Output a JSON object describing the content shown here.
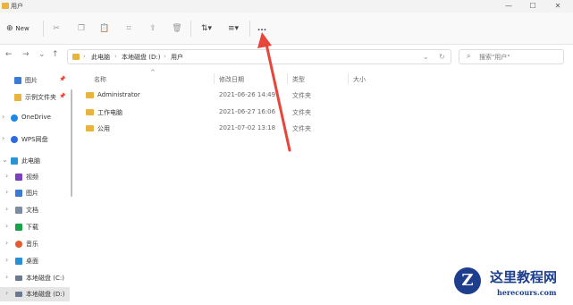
{
  "window": {
    "title": "用户",
    "min": "—",
    "max": "☐",
    "close": "✕"
  },
  "toolbar": {
    "new_label": "New",
    "icons": [
      "cut-icon",
      "copy-icon",
      "paste-icon",
      "rename-icon",
      "share-icon",
      "delete-icon",
      "sort-icon",
      "view-icon",
      "more-icon"
    ],
    "more_label": "..."
  },
  "address": {
    "crumbs": [
      "此电脑",
      "本地磁盘 (D:)",
      "用户"
    ],
    "search_placeholder": "搜索\"用户\""
  },
  "sidebar": {
    "items": [
      {
        "label": "图片",
        "pinned": true,
        "color": "#3a7bd5"
      },
      {
        "label": "示例文件夹",
        "pinned": true,
        "color": "#e8b43c"
      },
      {
        "label": "OneDrive",
        "color": "#1e88e5"
      },
      {
        "label": "WPS网盘",
        "color": "#2d6cdf"
      },
      {
        "label": "此电脑",
        "color": "#2a93d5"
      },
      {
        "label": "视频",
        "color": "#7b3fbf"
      },
      {
        "label": "图片",
        "color": "#3a7bd5"
      },
      {
        "label": "文档",
        "color": "#7d8ca3"
      },
      {
        "label": "下载",
        "color": "#1aa24b"
      },
      {
        "label": "音乐",
        "color": "#e45b2f"
      },
      {
        "label": "桌面",
        "color": "#2b8fd6"
      },
      {
        "label": "本地磁盘 (C:)",
        "color": "#6b7b8f"
      },
      {
        "label": "本地磁盘 (D:)",
        "color": "#6b7b8f"
      }
    ]
  },
  "main": {
    "columns": {
      "name": "名称",
      "date": "修改日期",
      "type": "类型",
      "size": "大小"
    },
    "rows": [
      {
        "name": "Administrator",
        "date": "2021-06-26 14:49",
        "type": "文件夹"
      },
      {
        "name": "工作电脑",
        "date": "2021-06-27 16:06",
        "type": "文件夹"
      },
      {
        "name": "公用",
        "date": "2021-07-02 13:18",
        "type": "文件夹"
      }
    ]
  },
  "watermark": {
    "logo": "Z",
    "title": "这里教程网",
    "url": "herecours.com"
  },
  "accent": {
    "annotation_arrow": "#e8463a",
    "folder": "#e8b43c",
    "brand": "#1d3e8c"
  }
}
